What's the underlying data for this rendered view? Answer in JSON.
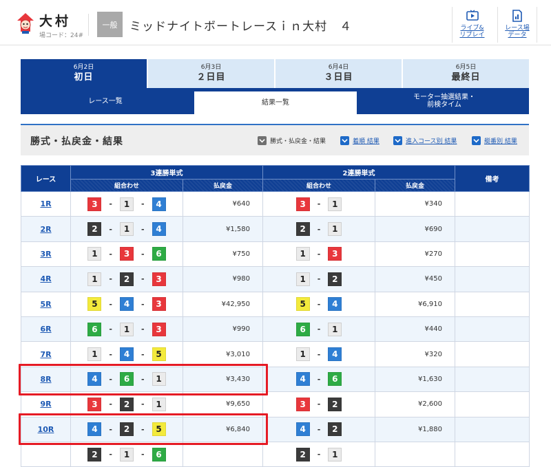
{
  "header": {
    "venue_name": "大村",
    "venue_code": "場コード：24#",
    "grade": "一般",
    "race_title": "ミッドナイトボートレースｉｎ大村　４",
    "live_label": "ライブ&\nリプレイ",
    "data_label": "レース場\nデータ"
  },
  "day_tabs": [
    {
      "date": "6月2日",
      "name": "初日",
      "active": true
    },
    {
      "date": "6月3日",
      "name": "２日目",
      "active": false
    },
    {
      "date": "6月4日",
      "name": "３日目",
      "active": false
    },
    {
      "date": "6月5日",
      "name": "最終日",
      "active": false
    }
  ],
  "sub_tabs": [
    {
      "label": "レース一覧"
    },
    {
      "label": "結果一覧"
    },
    {
      "label": "モーター抽選結果・\n前検タイム"
    }
  ],
  "section": {
    "title": "勝式・払戻金・結果",
    "filters": [
      "勝式・払戻金・結果",
      "着順 結果",
      "進入コース別 結果",
      "艇番別 結果"
    ]
  },
  "table": {
    "col_race": "レース",
    "col_3rentan": "3連勝単式",
    "col_2rentan": "2連勝単式",
    "col_note": "備考",
    "sub_combo": "組合わせ",
    "sub_pay": "払戻金",
    "rows": [
      {
        "race": "1R",
        "tri": [
          3,
          1,
          4
        ],
        "tri_pay": "¥640",
        "ex": [
          3,
          1
        ],
        "ex_pay": "¥340"
      },
      {
        "race": "2R",
        "tri": [
          2,
          1,
          4
        ],
        "tri_pay": "¥1,580",
        "ex": [
          2,
          1
        ],
        "ex_pay": "¥690"
      },
      {
        "race": "3R",
        "tri": [
          1,
          3,
          6
        ],
        "tri_pay": "¥750",
        "ex": [
          1,
          3
        ],
        "ex_pay": "¥270"
      },
      {
        "race": "4R",
        "tri": [
          1,
          2,
          3
        ],
        "tri_pay": "¥980",
        "ex": [
          1,
          2
        ],
        "ex_pay": "¥450"
      },
      {
        "race": "5R",
        "tri": [
          5,
          4,
          3
        ],
        "tri_pay": "¥42,950",
        "ex": [
          5,
          4
        ],
        "ex_pay": "¥6,910"
      },
      {
        "race": "6R",
        "tri": [
          6,
          1,
          3
        ],
        "tri_pay": "¥990",
        "ex": [
          6,
          1
        ],
        "ex_pay": "¥440"
      },
      {
        "race": "7R",
        "tri": [
          1,
          4,
          5
        ],
        "tri_pay": "¥3,010",
        "ex": [
          1,
          4
        ],
        "ex_pay": "¥320"
      },
      {
        "race": "8R",
        "tri": [
          4,
          6,
          1
        ],
        "tri_pay": "¥3,430",
        "ex": [
          4,
          6
        ],
        "ex_pay": "¥1,630"
      },
      {
        "race": "9R",
        "tri": [
          3,
          2,
          1
        ],
        "tri_pay": "¥9,650",
        "ex": [
          3,
          2
        ],
        "ex_pay": "¥2,600"
      },
      {
        "race": "10R",
        "tri": [
          4,
          2,
          5
        ],
        "tri_pay": "¥6,840",
        "ex": [
          4,
          2
        ],
        "ex_pay": "¥1,880"
      },
      {
        "race": "",
        "tri": [
          2,
          1,
          6
        ],
        "tri_pay": "",
        "ex": [
          2,
          1
        ],
        "ex_pay": ""
      }
    ]
  },
  "colors": {
    "navy": "#0f3f94",
    "annotation": "#e51a24"
  }
}
